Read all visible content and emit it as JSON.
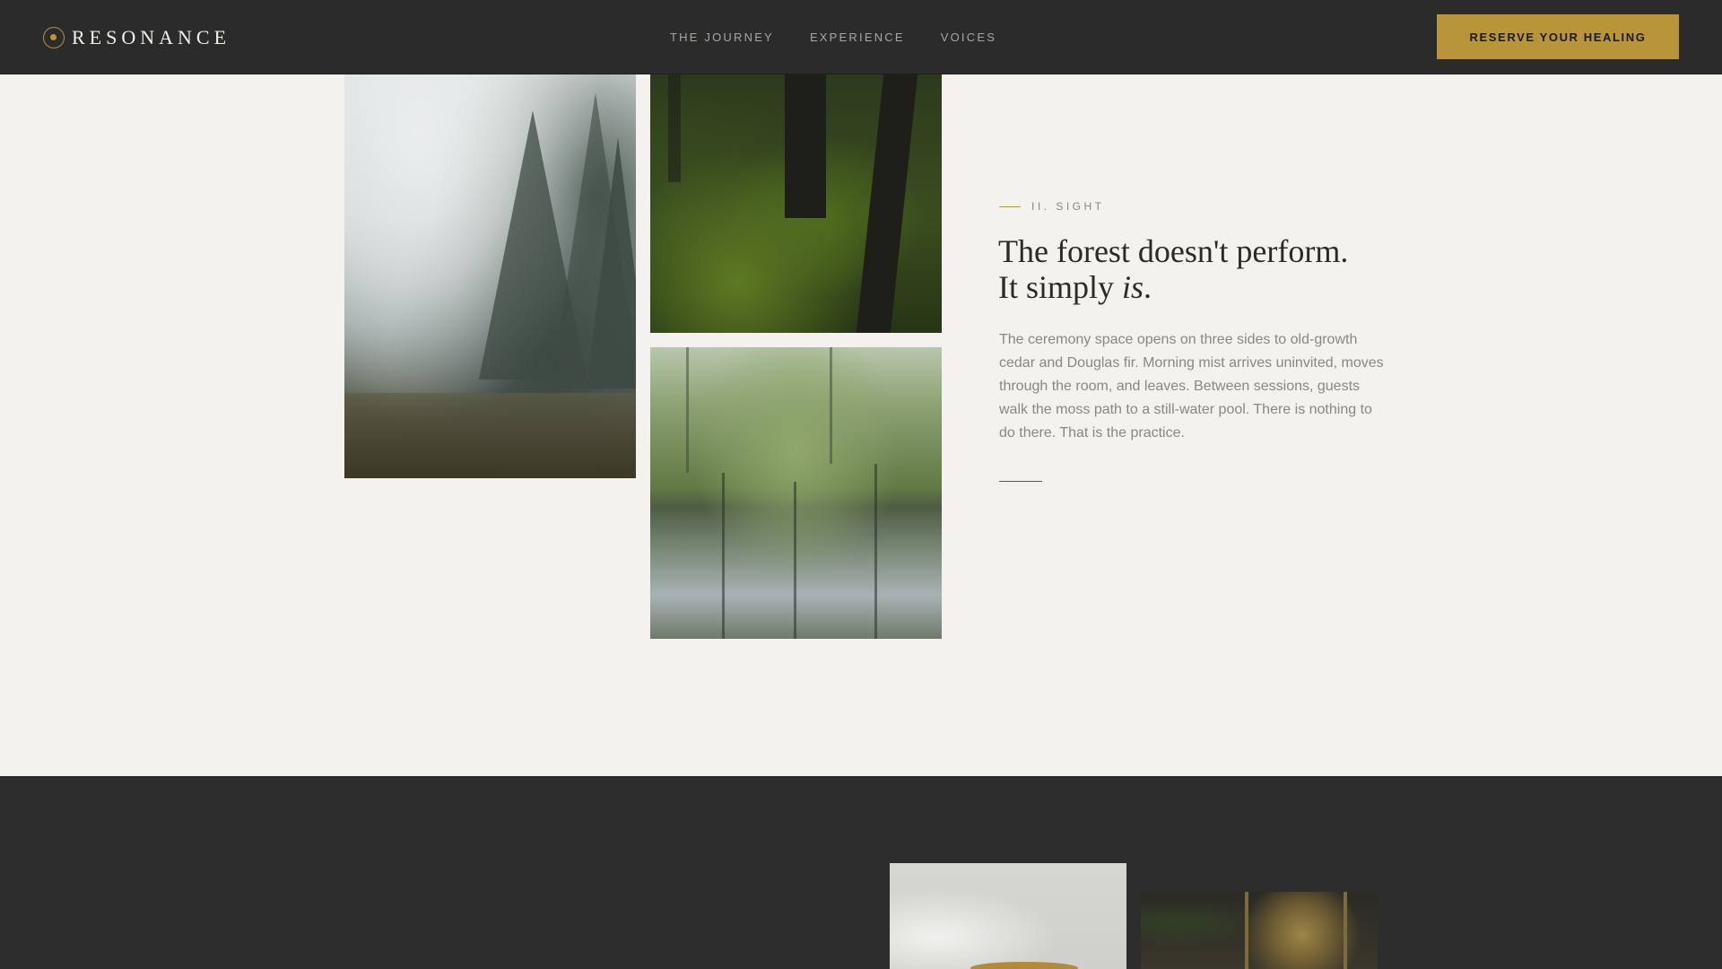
{
  "header": {
    "brand": "RESONANCE",
    "nav": [
      {
        "label": "THE JOURNEY"
      },
      {
        "label": "EXPERIENCE"
      },
      {
        "label": "VOICES"
      }
    ],
    "cta_label": "RESERVE YOUR HEALING"
  },
  "sight": {
    "eyebrow": "II. SIGHT",
    "headline_line1": "The forest doesn't perform.",
    "headline_line2_prefix": "It simply ",
    "headline_line2_em": "is",
    "headline_line2_suffix": ".",
    "body": "The ceremony space opens on three sides to old-growth cedar and Douglas fir. Morning mist arrives uninvited, moves through the room, and leaves. Between sessions, guests walk the moss path to a still-water pool. There is nothing to do there. That is the practice."
  },
  "colors": {
    "accent": "#b8943a",
    "nav_bg": "#2b2b2b",
    "page_bg": "#f3f2ee",
    "dark_section_bg": "#2d2d2d"
  }
}
